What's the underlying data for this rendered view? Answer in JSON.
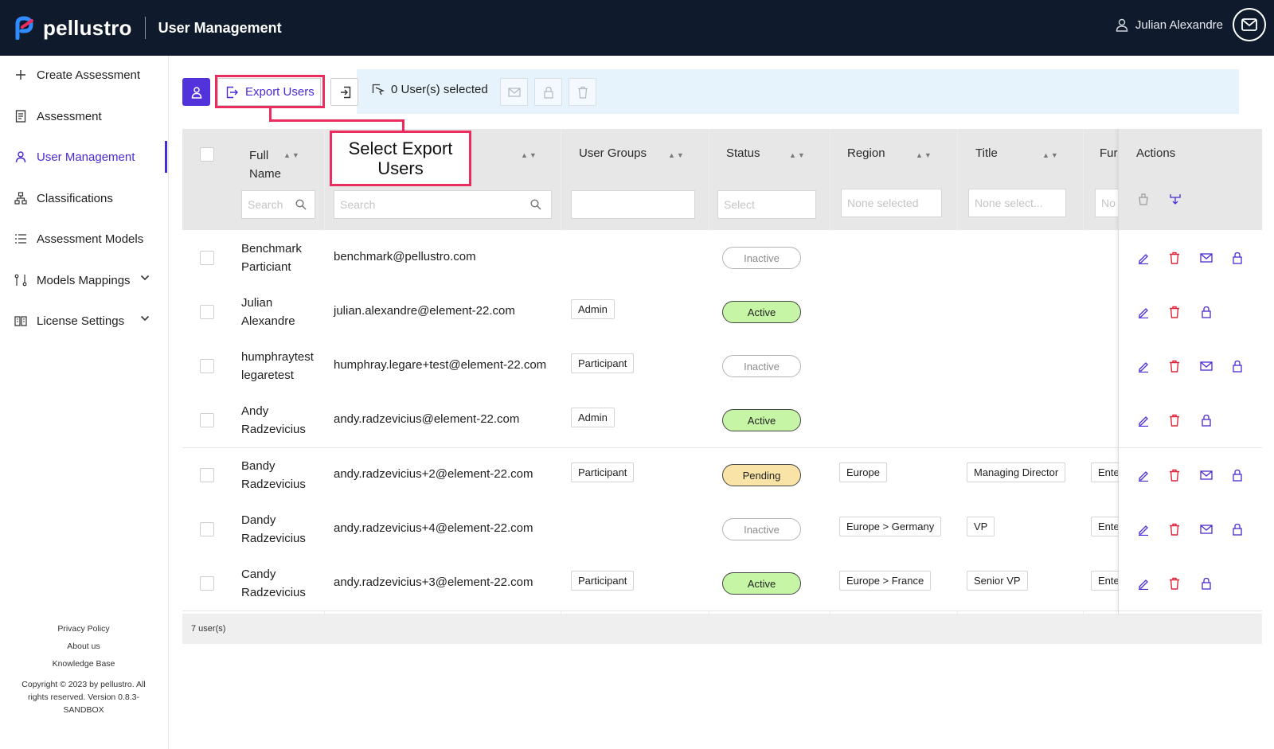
{
  "header": {
    "brand": "pellustro",
    "title": "User Management",
    "user_name": "Julian Alexandre"
  },
  "sidebar": {
    "items": [
      {
        "label": "Create Assessment",
        "icon": "plus-icon"
      },
      {
        "label": "Assessment",
        "icon": "document-icon"
      },
      {
        "label": "User Management",
        "icon": "user-icon",
        "active": true
      },
      {
        "label": "Classifications",
        "icon": "hierarchy-icon"
      },
      {
        "label": "Assessment Models",
        "icon": "list-icon"
      },
      {
        "label": "Models Mappings",
        "icon": "mapping-icon",
        "expandable": true
      },
      {
        "label": "License Settings",
        "icon": "book-icon",
        "expandable": true
      }
    ],
    "footer": {
      "privacy": "Privacy Policy",
      "about": "About us",
      "kb": "Knowledge Base",
      "copyright": "Copyright © 2023 by pellustro. All rights reserved. Version 0.8.3-SANDBOX"
    }
  },
  "toolbar": {
    "export_label": "Export Users",
    "selected_label": "0 User(s) selected"
  },
  "callout": {
    "line1": "Select Export",
    "line2": "Users"
  },
  "table": {
    "headers": {
      "full_name_1": "Full",
      "full_name_2": "Name",
      "user_groups": "User Groups",
      "status": "Status",
      "region": "Region",
      "title": "Title",
      "function": "Fur",
      "actions": "Actions"
    },
    "filters": {
      "name_placeholder": "Search",
      "email_placeholder": "Search",
      "status_placeholder": "Select",
      "region_placeholder": "None selected",
      "title_placeholder": "None select...",
      "function_placeholder": "No"
    },
    "rows": [
      {
        "name1": "Benchmark",
        "name2": "Particiant",
        "email": "benchmark@pellustro.com",
        "group": "",
        "status": "Inactive",
        "region": "",
        "title": "",
        "function": "",
        "has_mail": true
      },
      {
        "name1": "Julian",
        "name2": "Alexandre",
        "email": "julian.alexandre@element-22.com",
        "group": "Admin",
        "status": "Active",
        "region": "",
        "title": "",
        "function": "",
        "has_mail": false
      },
      {
        "name1": "humphraytest",
        "name2": "legaretest",
        "email": "humphray.legare+test@element-22.com",
        "group": "Participant",
        "status": "Inactive",
        "region": "",
        "title": "",
        "function": "",
        "has_mail": true
      },
      {
        "name1": "Andy",
        "name2": "Radzevicius",
        "email": "andy.radzevicius@element-22.com",
        "group": "Admin",
        "status": "Active",
        "region": "",
        "title": "",
        "function": "",
        "has_mail": false
      },
      {
        "name1": "Bandy",
        "name2": "Radzevicius",
        "email": "andy.radzevicius+2@element-22.com",
        "group": "Participant",
        "status": "Pending",
        "region": "Europe",
        "title": "Managing Director",
        "function": "Ente",
        "has_mail": true
      },
      {
        "name1": "Dandy",
        "name2": "Radzevicius",
        "email": "andy.radzevicius+4@element-22.com",
        "group": "",
        "status": "Inactive",
        "region": "Europe > Germany",
        "title": "VP",
        "function": "Ente",
        "has_mail": true
      },
      {
        "name1": "Candy",
        "name2": "Radzevicius",
        "email": "andy.radzevicius+3@element-22.com",
        "group": "Participant",
        "status": "Active",
        "region": "Europe > France",
        "title": "Senior VP",
        "function": "Ente",
        "has_mail": false
      }
    ],
    "footer_count": "7 user(s)"
  },
  "colors": {
    "topbar": "#0f1b2d",
    "accent": "#4a2ad3",
    "highlight": "#ea2c5f",
    "active_badge": "#c7f5a6",
    "pending_badge": "#f9e3a6"
  }
}
